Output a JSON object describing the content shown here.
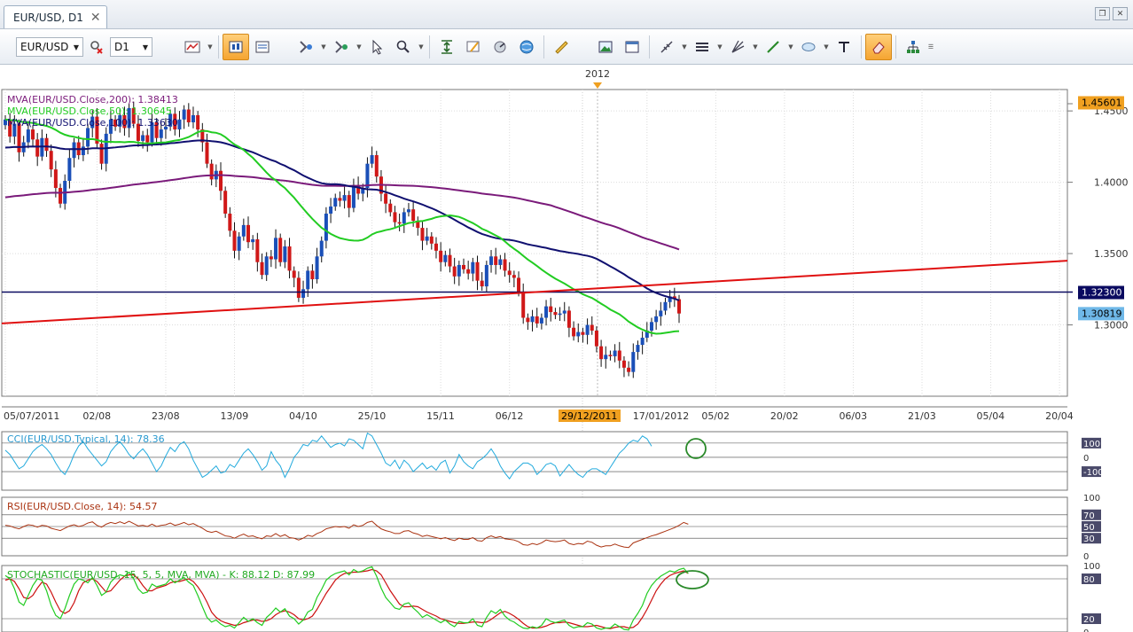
{
  "tab": {
    "title": "EUR/USD, D1"
  },
  "toolbar": {
    "symbol": "EUR/USD",
    "timeframe": "D1"
  },
  "main_chart": {
    "year_label": "2012",
    "indicators": [
      {
        "label": "MVA(EUR/USD.Close,200): 1.38413",
        "color": "#7a1a7a"
      },
      {
        "label": "MVA(EUR/USD.Close,50): 1.30645",
        "color": "#22cc22"
      },
      {
        "label": "MVA(EUR/USD.Close,100): 1.33630",
        "color": "#101070"
      }
    ],
    "price_labels": [
      {
        "text": "1.45601",
        "value": 1.456,
        "bg": "#f0a020",
        "fg": "#000000"
      },
      {
        "text": "1.32300",
        "value": 1.323,
        "bg": "#0a0a60",
        "fg": "#ffffff"
      },
      {
        "text": "1.30819",
        "value": 1.30819,
        "bg": "#6fb8e8",
        "fg": "#000000"
      }
    ],
    "highlighted_date": "29/12/2011"
  },
  "chart_data": [
    {
      "type": "candlestick",
      "title": "EUR/USD, D1",
      "ylim": [
        1.25,
        1.465
      ],
      "y_ticks": [
        "1.4500",
        "1.4000",
        "1.3500",
        "1.3000"
      ],
      "y_tick_values": [
        1.45,
        1.4,
        1.35,
        1.3
      ],
      "x_ticks": [
        "05/07/2011",
        "02/08",
        "23/08",
        "13/09",
        "04/10",
        "25/10",
        "15/11",
        "06/12",
        "17/01/2012",
        "05/02",
        "20/02",
        "06/03",
        "21/03",
        "05/04",
        "20/04"
      ],
      "x_tick_index": [
        0,
        20,
        35,
        50,
        65,
        80,
        95,
        110,
        140,
        155,
        170,
        185,
        200,
        215,
        230
      ],
      "close": [
        1.444,
        1.432,
        1.441,
        1.421,
        1.428,
        1.437,
        1.43,
        1.418,
        1.431,
        1.422,
        1.409,
        1.396,
        1.385,
        1.401,
        1.417,
        1.428,
        1.419,
        1.425,
        1.438,
        1.446,
        1.427,
        1.413,
        1.434,
        1.444,
        1.439,
        1.447,
        1.438,
        1.452,
        1.441,
        1.429,
        1.433,
        1.428,
        1.442,
        1.431,
        1.437,
        1.439,
        1.448,
        1.437,
        1.444,
        1.451,
        1.442,
        1.447,
        1.437,
        1.428,
        1.413,
        1.402,
        1.408,
        1.394,
        1.378,
        1.366,
        1.352,
        1.362,
        1.37,
        1.358,
        1.36,
        1.344,
        1.335,
        1.348,
        1.346,
        1.361,
        1.344,
        1.355,
        1.338,
        1.333,
        1.319,
        1.325,
        1.338,
        1.332,
        1.348,
        1.359,
        1.378,
        1.383,
        1.389,
        1.387,
        1.391,
        1.382,
        1.398,
        1.392,
        1.396,
        1.413,
        1.419,
        1.404,
        1.392,
        1.385,
        1.379,
        1.372,
        1.371,
        1.379,
        1.381,
        1.373,
        1.368,
        1.359,
        1.362,
        1.357,
        1.352,
        1.344,
        1.349,
        1.341,
        1.334,
        1.342,
        1.339,
        1.336,
        1.344,
        1.331,
        1.327,
        1.342,
        1.348,
        1.342,
        1.346,
        1.338,
        1.335,
        1.333,
        1.323,
        1.305,
        1.302,
        1.306,
        1.301,
        1.305,
        1.313,
        1.309,
        1.307,
        1.308,
        1.31,
        1.298,
        1.292,
        1.295,
        1.293,
        1.3,
        1.296,
        1.285,
        1.276,
        1.279,
        1.278,
        1.282,
        1.275,
        1.27,
        1.267,
        1.281,
        1.286,
        1.291,
        1.296,
        1.302,
        1.306,
        1.31,
        1.316,
        1.32,
        1.318,
        1.308
      ],
      "mva_200": {
        "name": "MVA(EUR/USD.Close,200)",
        "color": "#7a1a7a"
      },
      "mva_50": {
        "name": "MVA(EUR/USD.Close,50)",
        "color": "#22cc22"
      },
      "mva_100": {
        "name": "MVA(EUR/USD.Close,100)",
        "color": "#101070"
      },
      "hline": 1.323,
      "trendline": {
        "from": [
          0,
          1.301
        ],
        "to": [
          238,
          1.345
        ]
      }
    },
    {
      "type": "line",
      "title": "CCI(EUR/USD.Typical, 14): 78.36",
      "ylim": [
        -230,
        180
      ],
      "y_ticks": [
        "100",
        "0",
        "-100"
      ],
      "y_tick_values": [
        100,
        0,
        -100
      ],
      "color": "#22aadd",
      "values": [
        50,
        20,
        -30,
        -80,
        -60,
        -10,
        40,
        70,
        90,
        60,
        20,
        -40,
        -90,
        -120,
        -60,
        20,
        80,
        110,
        60,
        20,
        -20,
        -60,
        -30,
        40,
        80,
        110,
        70,
        20,
        -10,
        30,
        60,
        20,
        -40,
        -100,
        -60,
        10,
        70,
        40,
        90,
        110,
        60,
        -20,
        -80,
        -140,
        -120,
        -90,
        -60,
        -110,
        -100,
        -50,
        -70,
        -20,
        30,
        60,
        20,
        -30,
        -90,
        -60,
        40,
        -20,
        -60,
        -140,
        -80,
        0,
        40,
        90,
        80,
        120,
        110,
        150,
        110,
        70,
        90,
        100,
        80,
        130,
        120,
        90,
        60,
        170,
        150,
        90,
        30,
        -40,
        -60,
        -20,
        -80,
        -20,
        -50,
        -100,
        -70,
        -40,
        -80,
        -60,
        -90,
        -40,
        -20,
        -110,
        -60,
        20,
        -30,
        -60,
        -80,
        -30,
        -10,
        20,
        60,
        10,
        -60,
        -110,
        -150,
        -100,
        -70,
        -40,
        -40,
        -60,
        -120,
        -90,
        -50,
        -40,
        -60,
        -130,
        -90,
        -50,
        -90,
        -120,
        -140,
        -100,
        -80,
        -80,
        -100,
        -120,
        -70,
        -20,
        30,
        60,
        100,
        120,
        110,
        150,
        130,
        78
      ]
    },
    {
      "type": "line",
      "title": "RSI(EUR/USD.Close, 14): 54.57",
      "ylim": [
        0,
        100
      ],
      "y_ticks": [
        "100",
        "70",
        "50",
        "30",
        "0"
      ],
      "y_tick_values": [
        100,
        70,
        50,
        30,
        0
      ],
      "color": "#aa3311",
      "values": [
        52,
        51,
        48,
        46,
        50,
        53,
        52,
        49,
        52,
        51,
        47,
        45,
        43,
        47,
        51,
        53,
        50,
        52,
        56,
        58,
        52,
        49,
        54,
        57,
        55,
        58,
        55,
        59,
        55,
        51,
        52,
        50,
        54,
        50,
        52,
        53,
        56,
        52,
        54,
        57,
        53,
        55,
        51,
        47,
        42,
        40,
        42,
        38,
        34,
        33,
        30,
        34,
        37,
        33,
        34,
        31,
        29,
        34,
        33,
        38,
        33,
        36,
        31,
        30,
        27,
        30,
        35,
        33,
        38,
        41,
        46,
        48,
        50,
        49,
        50,
        47,
        53,
        50,
        52,
        57,
        59,
        52,
        46,
        43,
        41,
        38,
        38,
        42,
        43,
        39,
        37,
        33,
        35,
        33,
        31,
        29,
        31,
        28,
        26,
        30,
        28,
        28,
        31,
        26,
        25,
        31,
        34,
        31,
        33,
        29,
        28,
        27,
        24,
        19,
        18,
        21,
        19,
        22,
        27,
        25,
        24,
        25,
        27,
        21,
        19,
        21,
        20,
        25,
        23,
        18,
        15,
        17,
        17,
        20,
        17,
        15,
        14,
        22,
        25,
        28,
        31,
        34,
        36,
        39,
        42,
        45,
        48,
        52,
        57,
        54
      ]
    },
    {
      "type": "line",
      "title": "STOCHASTIC(EUR/USD, 15, 5, 5, MVA, MVA) -  K: 88.12   D: 87.99",
      "ylim": [
        0,
        100
      ],
      "y_ticks": [
        "100",
        "80",
        "20",
        "0"
      ],
      "y_tick_values": [
        100,
        80,
        20,
        0
      ],
      "series": [
        {
          "name": "K",
          "color": "#22cc22",
          "values": [
            85,
            80,
            65,
            45,
            40,
            55,
            70,
            80,
            78,
            62,
            40,
            25,
            20,
            35,
            55,
            72,
            80,
            78,
            74,
            82,
            70,
            55,
            60,
            75,
            82,
            86,
            84,
            90,
            80,
            65,
            58,
            60,
            72,
            68,
            70,
            72,
            80,
            74,
            78,
            82,
            75,
            70,
            55,
            38,
            22,
            15,
            18,
            12,
            8,
            10,
            6,
            14,
            22,
            16,
            20,
            14,
            10,
            22,
            28,
            36,
            30,
            35,
            24,
            20,
            12,
            18,
            30,
            34,
            52,
            64,
            78,
            84,
            88,
            90,
            92,
            86,
            94,
            90,
            92,
            96,
            98,
            84,
            66,
            52,
            44,
            36,
            34,
            42,
            44,
            36,
            30,
            22,
            26,
            22,
            18,
            14,
            18,
            12,
            8,
            16,
            14,
            14,
            20,
            10,
            8,
            22,
            32,
            28,
            34,
            24,
            18,
            15,
            10,
            6,
            5,
            8,
            6,
            10,
            20,
            16,
            14,
            16,
            18,
            10,
            6,
            8,
            8,
            14,
            12,
            6,
            4,
            6,
            6,
            12,
            8,
            4,
            3,
            18,
            28,
            40,
            58,
            70,
            78,
            84,
            88,
            92,
            90,
            94,
            96,
            88
          ]
        },
        {
          "name": "D",
          "color": "#cc1111",
          "values": [
            78,
            80,
            76,
            65,
            52,
            50,
            55,
            66,
            75,
            72,
            60,
            45,
            32,
            28,
            32,
            44,
            62,
            74,
            78,
            80,
            76,
            68,
            60,
            62,
            70,
            78,
            84,
            86,
            86,
            80,
            70,
            62,
            62,
            66,
            68,
            70,
            74,
            76,
            76,
            78,
            80,
            76,
            68,
            58,
            45,
            30,
            22,
            17,
            14,
            12,
            10,
            11,
            14,
            16,
            18,
            18,
            16,
            17,
            20,
            26,
            30,
            32,
            30,
            26,
            20,
            18,
            20,
            24,
            34,
            46,
            58,
            68,
            78,
            84,
            88,
            89,
            90,
            90,
            91,
            92,
            94,
            92,
            86,
            74,
            62,
            52,
            42,
            38,
            38,
            39,
            38,
            34,
            30,
            27,
            24,
            20,
            18,
            16,
            14,
            13,
            13,
            14,
            15,
            15,
            14,
            15,
            19,
            24,
            29,
            31,
            28,
            24,
            19,
            13,
            8,
            6,
            6,
            7,
            9,
            12,
            14,
            14,
            15,
            14,
            12,
            10,
            8,
            8,
            9,
            10,
            8,
            6,
            5,
            7,
            8,
            8,
            6,
            7,
            12,
            22,
            34,
            48,
            62,
            72,
            80,
            85,
            88,
            90,
            92,
            88
          ]
        }
      ]
    }
  ]
}
